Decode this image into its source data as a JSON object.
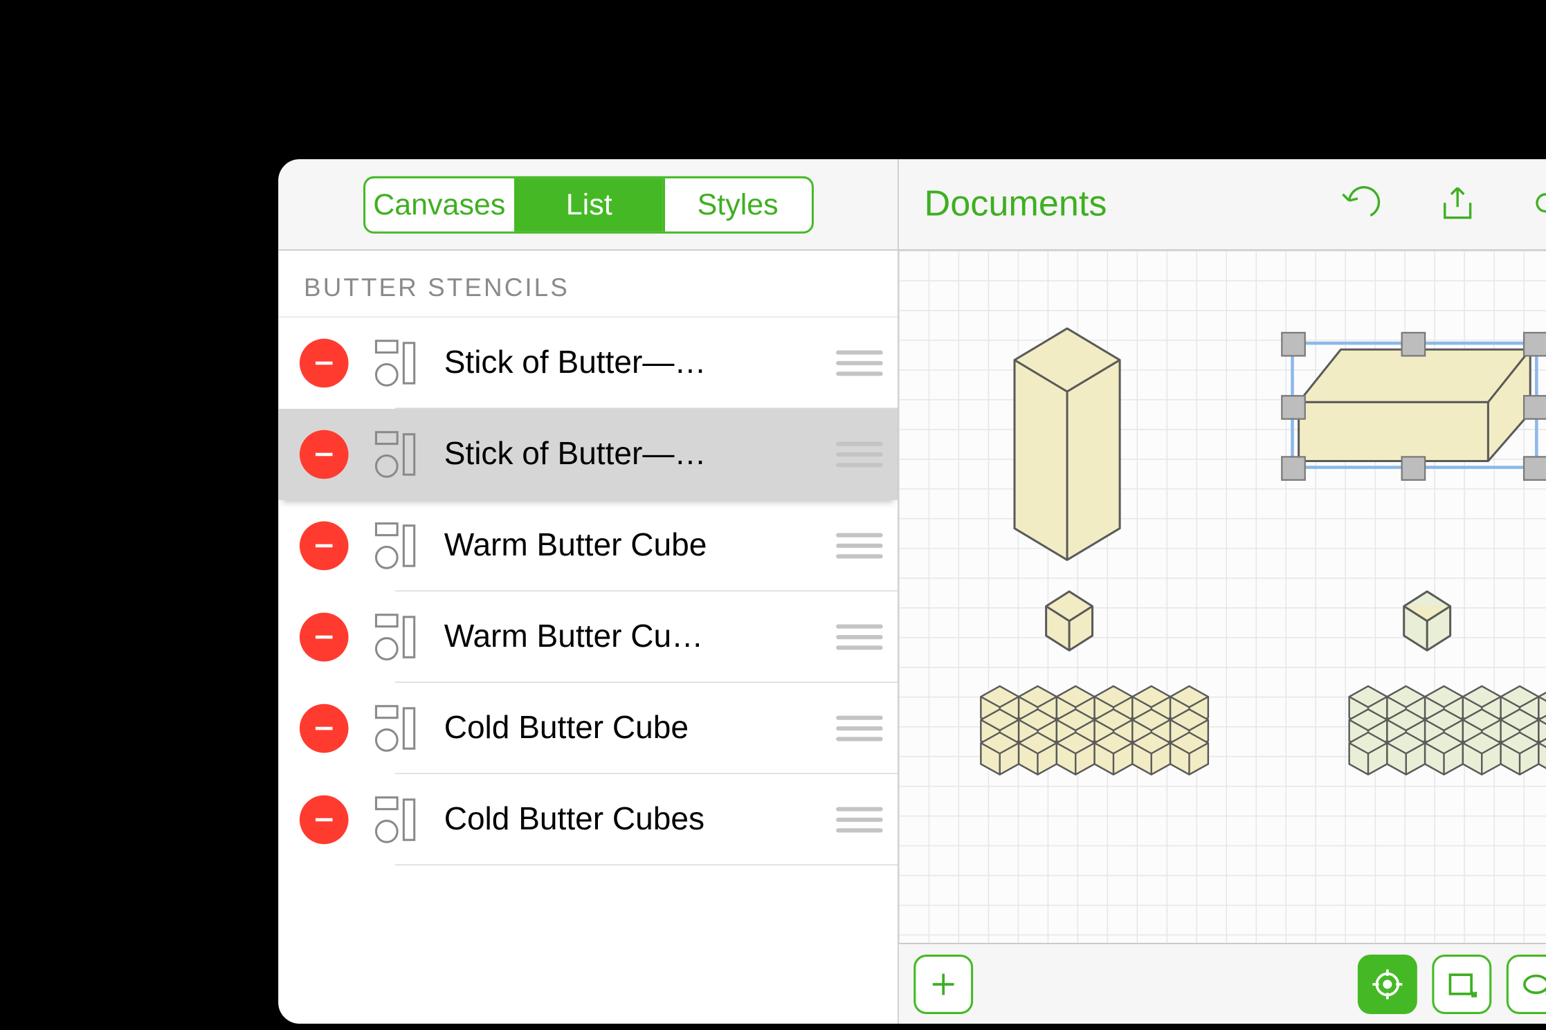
{
  "segmented": {
    "canvases": "Canvases",
    "list": "List",
    "styles": "Styles",
    "active": "list"
  },
  "section": {
    "title": "BUTTER STENCILS"
  },
  "rows": [
    {
      "label": "Stick of Butter—…",
      "selected": false
    },
    {
      "label": "Stick of Butter—…",
      "selected": true
    },
    {
      "label": "Warm Butter Cube",
      "selected": false
    },
    {
      "label": "Warm Butter Cu…",
      "selected": false
    },
    {
      "label": "Cold Butter Cube",
      "selected": false
    },
    {
      "label": "Cold Butter Cubes",
      "selected": false
    }
  ],
  "header": {
    "back": "Documents"
  },
  "icons": {
    "undo": "undo-icon",
    "share": "share-icon",
    "sync": "cloud-sync-icon",
    "layers": "layers-icon",
    "info": "info-icon",
    "add": "plus-icon",
    "target": "target-icon",
    "rect": "rect-tool-icon",
    "ellipse": "ellipse-tool-icon",
    "line": "line-tool-icon",
    "text": "text-tool-icon",
    "touch": "touch-tool-icon"
  }
}
